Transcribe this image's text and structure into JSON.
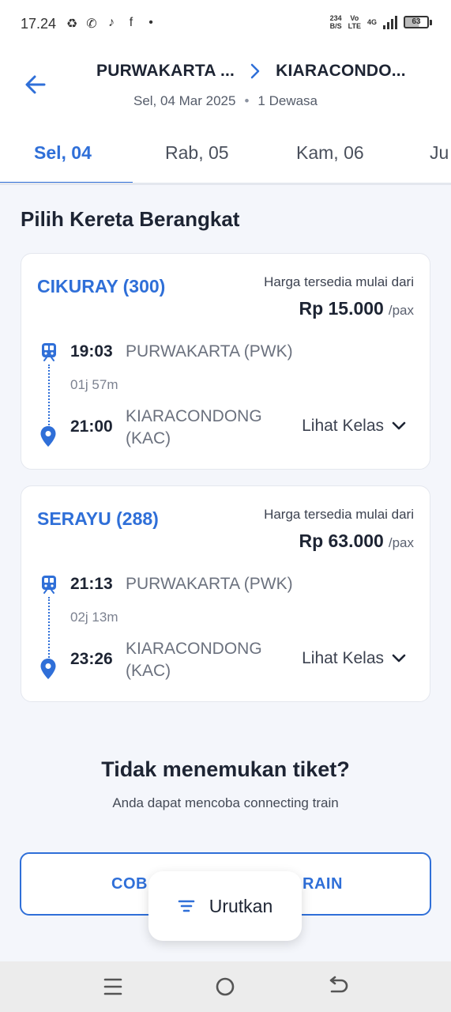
{
  "status_bar": {
    "time": "17.24",
    "net_speed_value": "234",
    "net_speed_unit": "B/S",
    "volte_top": "Vo",
    "volte_bottom": "LTE",
    "network": "4G",
    "battery": "63"
  },
  "header": {
    "origin": "PURWAKARTA ...",
    "destination": "KIARACONDO...",
    "date": "Sel, 04 Mar 2025",
    "passengers": "1 Dewasa"
  },
  "date_tabs": [
    {
      "label": "Sel, 04",
      "active": true
    },
    {
      "label": "Rab, 05",
      "active": false
    },
    {
      "label": "Kam, 06",
      "active": false
    },
    {
      "label": "Ju",
      "active": false
    }
  ],
  "section_title": "Pilih Kereta Berangkat",
  "trains": [
    {
      "name": "CIKURAY (300)",
      "price_label": "Harga tersedia mulai dari",
      "price": "Rp 15.000",
      "price_unit": "/pax",
      "departure_time": "19:03",
      "departure_station": "PURWAKARTA (PWK)",
      "duration": "01j 57m",
      "arrival_time": "21:00",
      "arrival_station_line1": "KIARACONDONG",
      "arrival_station_line2": "(KAC)",
      "view_class": "Lihat Kelas"
    },
    {
      "name": "SERAYU (288)",
      "price_label": "Harga tersedia mulai dari",
      "price": "Rp 63.000",
      "price_unit": "/pax",
      "departure_time": "21:13",
      "departure_station": "PURWAKARTA (PWK)",
      "duration": "02j 13m",
      "arrival_time": "23:26",
      "arrival_station_line1": "KIARACONDONG",
      "arrival_station_line2": "(KAC)",
      "view_class": "Lihat Kelas"
    }
  ],
  "not_found": {
    "title": "Tidak menemukan tiket?",
    "subtitle": "Anda dapat mencoba connecting train"
  },
  "connect_button": {
    "visible_left": "COB",
    "visible_right": "RAIN"
  },
  "sort_button": {
    "label": "Urutkan"
  },
  "colors": {
    "accent": "#2f6fd8",
    "background": "#f4f6fb",
    "text": "#1d2433"
  },
  "icons": {
    "back": "arrow-left-icon",
    "route": "chevron-right-icon",
    "train": "train-icon",
    "pin": "location-pin-icon",
    "expand": "chevron-down-icon",
    "sort": "filter-lines-icon"
  }
}
